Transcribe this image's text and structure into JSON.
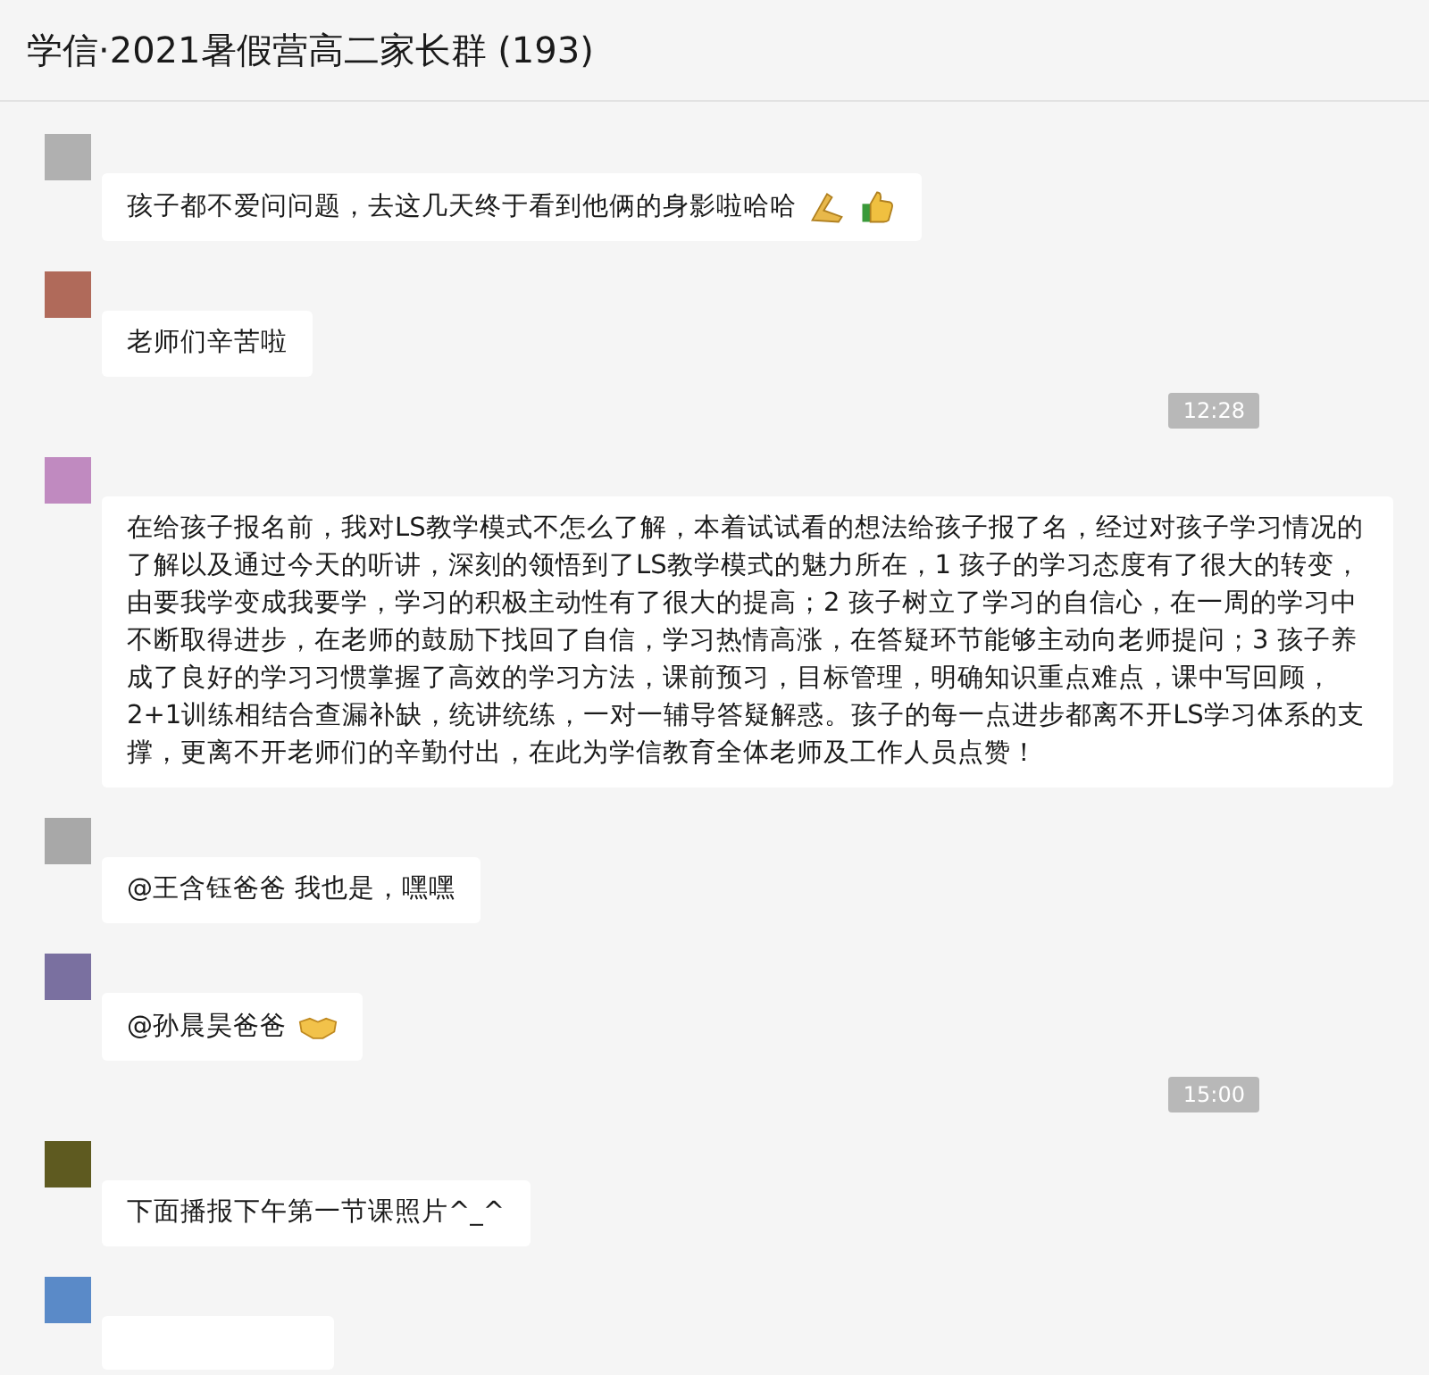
{
  "window": {
    "title": "学信·2021暑假营高二家长群 (193)"
  },
  "messages": [
    {
      "kind": "text",
      "color": "#b0b0b0",
      "text": "孩子都不爱问问题，去这几天终于看到他俩的身影啦哈哈",
      "emojis": [
        {
          "kind": "hands"
        },
        {
          "kind": "thumbs"
        }
      ]
    },
    {
      "kind": "text",
      "color": "#b06a5a",
      "text": "老师们辛苦啦"
    },
    {
      "kind": "time",
      "text": "12:28"
    },
    {
      "kind": "text",
      "color": "#c08ac0",
      "text": "在给孩子报名前，我对LS教学模式不怎么了解，本着试试看的想法给孩子报了名，经过对孩子学习情况的了解以及通过今天的听讲，深刻的领悟到了LS教学模式的魅力所在，1 孩子的学习态度有了很大的转变，由要我学变成我要学，学习的积极主动性有了很大的提高；2 孩子树立了学习的自信心，在一周的学习中不断取得进步，在老师的鼓励下找回了自信，学习热情高涨，在答疑环节能够主动向老师提问；3  孩子养成了良好的学习习惯掌握了高效的学习方法，课前预习，目标管理，明确知识重点难点，课中写回顾，2+1训练相结合查漏补缺，统讲统练，一对一辅导答疑解惑。孩子的每一点进步都离不开LS学习体系的支撑，更离不开老师们的辛勤付出，在此为学信教育全体老师及工作人员点赞！"
    },
    {
      "kind": "text",
      "color": "#a8a8a8",
      "text": "@王含钰爸爸 我也是，嘿嘿"
    },
    {
      "kind": "text",
      "color": "#7a70a0",
      "text": "@孙晨昊爸爸",
      "emojis": [
        {
          "kind": "handshake"
        }
      ]
    },
    {
      "kind": "time",
      "text": "15:00"
    },
    {
      "kind": "text",
      "color": "#5e5a20",
      "text": "下面播报下午第一节课照片^_^"
    },
    {
      "kind": "cut",
      "color": "#5a8ac8"
    }
  ]
}
